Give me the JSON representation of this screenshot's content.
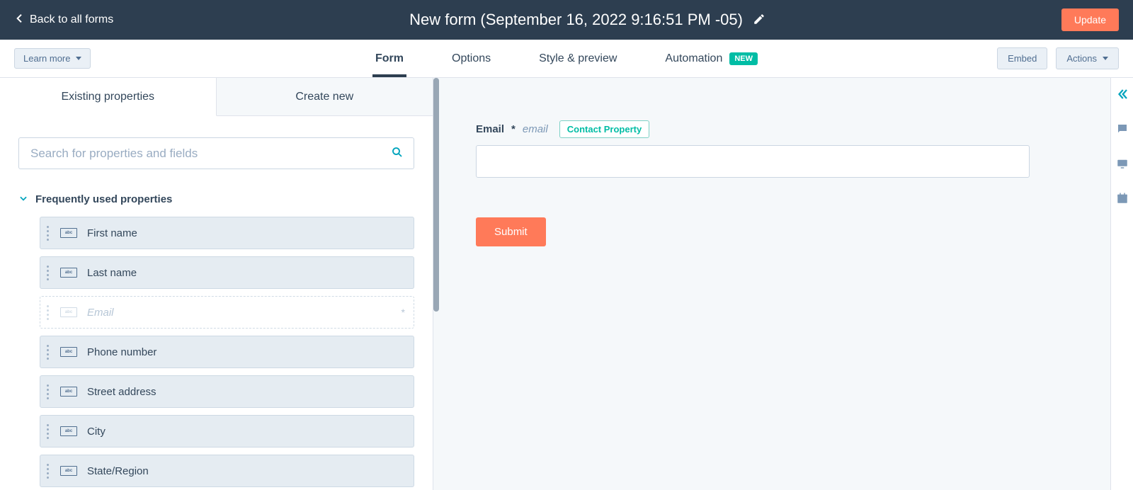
{
  "header": {
    "back_label": "Back to all forms",
    "title": "New form (September 16, 2022 9:16:51 PM -05)",
    "update_label": "Update"
  },
  "subnav": {
    "learn_more_label": "Learn more",
    "tabs": [
      {
        "label": "Form",
        "active": true,
        "badge": ""
      },
      {
        "label": "Options",
        "active": false,
        "badge": ""
      },
      {
        "label": "Style & preview",
        "active": false,
        "badge": ""
      },
      {
        "label": "Automation",
        "active": false,
        "badge": "NEW"
      }
    ],
    "embed_label": "Embed",
    "actions_label": "Actions"
  },
  "left_panel": {
    "tabs": {
      "existing": "Existing properties",
      "create": "Create new"
    },
    "search_placeholder": "Search for properties and fields",
    "section_title": "Frequently used properties",
    "properties": [
      {
        "label": "First name",
        "state": "available"
      },
      {
        "label": "Last name",
        "state": "available"
      },
      {
        "label": "Email",
        "state": "disabled",
        "star": "*"
      },
      {
        "label": "Phone number",
        "state": "available"
      },
      {
        "label": "Street address",
        "state": "available"
      },
      {
        "label": "City",
        "state": "available"
      },
      {
        "label": "State/Region",
        "state": "available"
      }
    ]
  },
  "canvas": {
    "field": {
      "label": "Email",
      "required_marker": "*",
      "internal_name": "email",
      "tag": "Contact Property"
    },
    "submit_label": "Submit"
  },
  "colors": {
    "orange": "#ff7a59",
    "teal": "#00a4bd",
    "new_badge": "#00bda5",
    "dark": "#2d3e50"
  }
}
